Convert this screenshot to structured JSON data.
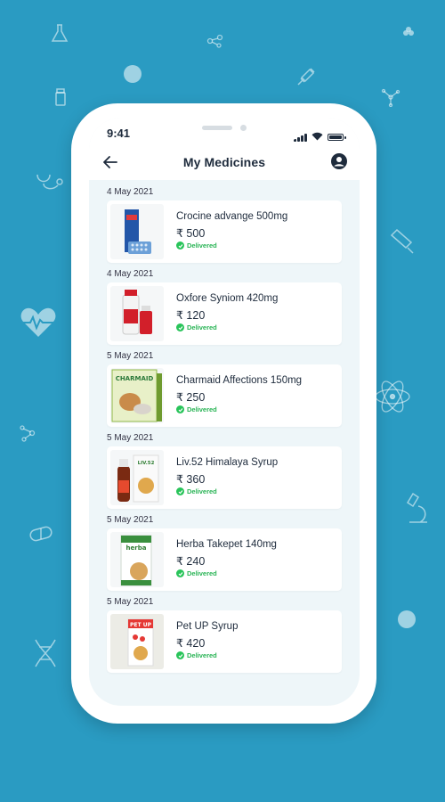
{
  "status_bar": {
    "time": "9:41"
  },
  "header": {
    "title": "My Medicines",
    "back_icon": "back-arrow-icon",
    "profile_icon": "user-profile-icon"
  },
  "colors": {
    "background": "#2a9bc2",
    "delivered": "#29c45a",
    "text": "#1e2b3c"
  },
  "orders": [
    {
      "date": "4 May 2021",
      "name": "Crocine advange 500mg",
      "price": "₹ 500",
      "status": "Delivered"
    },
    {
      "date": "4 May 2021",
      "name": "Oxfore Syniom 420mg",
      "price": "₹ 120",
      "status": "Delivered"
    },
    {
      "date": "5 May 2021",
      "name": "Charmaid Affections 150mg",
      "price": "₹ 250",
      "status": "Delivered",
      "package_text": "CHARMAID"
    },
    {
      "date": "5 May 2021",
      "name": "Liv.52 Himalaya Syrup",
      "price": "₹ 360",
      "status": "Delivered",
      "package_text": "LIV.52"
    },
    {
      "date": "5 May 2021",
      "name": "Herba Takepet 140mg",
      "price": "₹ 240",
      "status": "Delivered",
      "package_text": "herba"
    },
    {
      "date": "5 May 2021",
      "name": "Pet UP Syrup",
      "price": "₹ 420",
      "status": "Delivered",
      "package_text": "PET UP"
    }
  ]
}
